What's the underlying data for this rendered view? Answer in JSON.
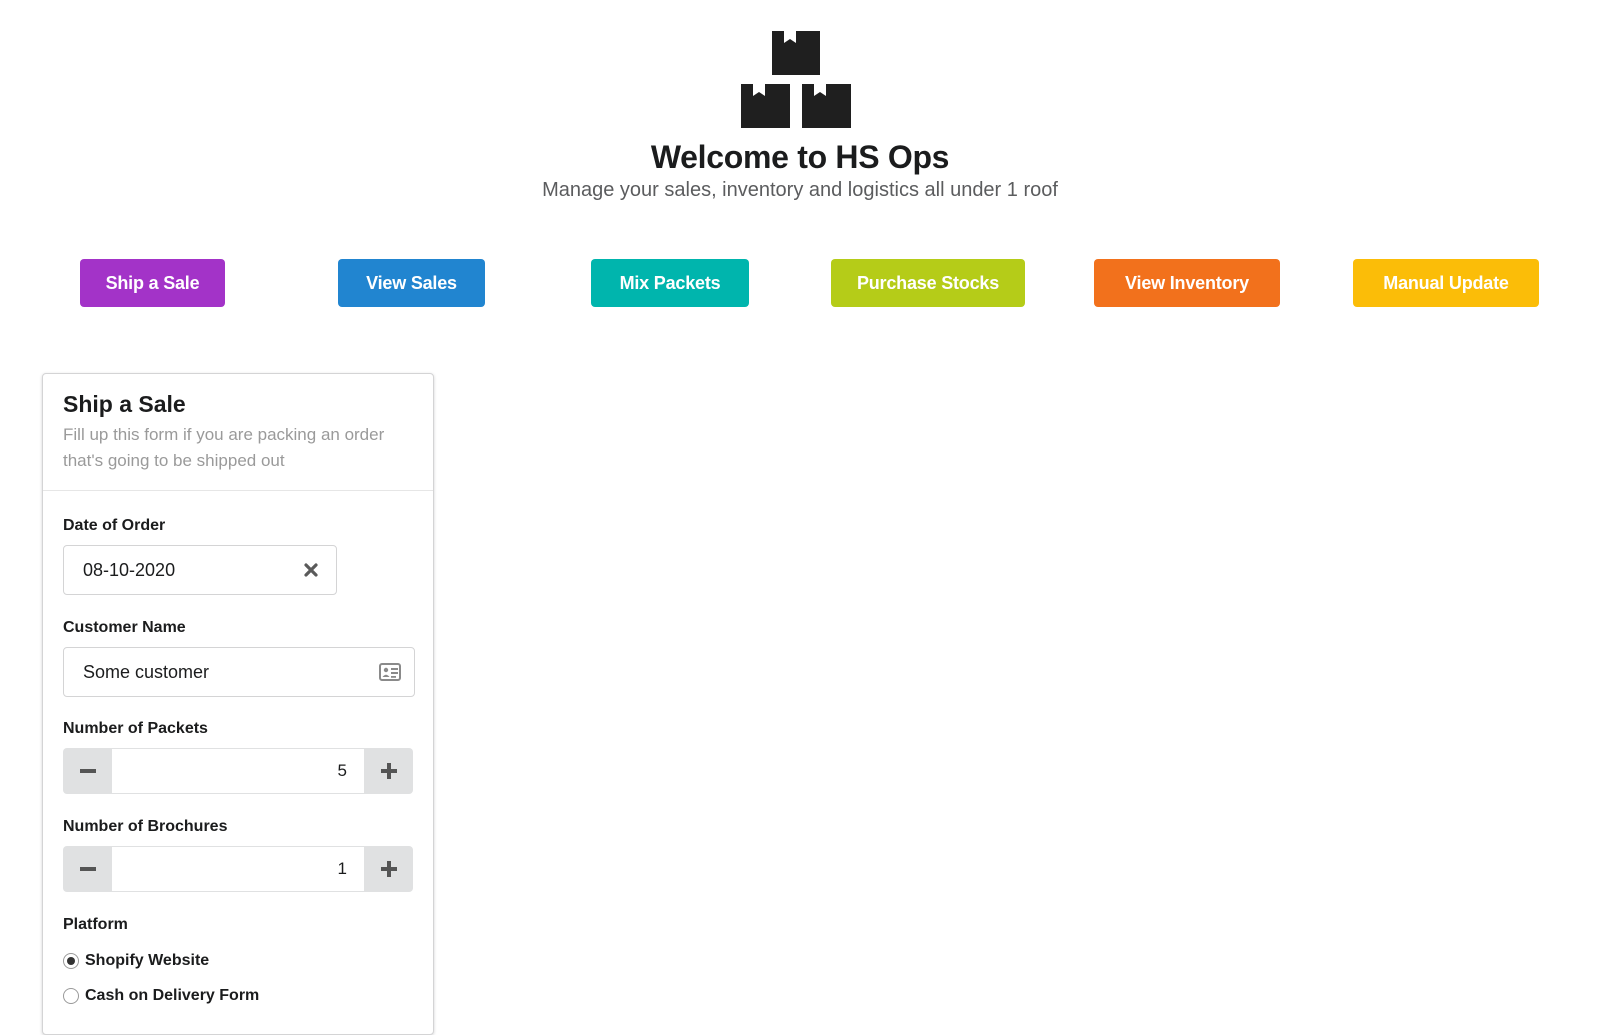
{
  "header": {
    "logo_icon": "boxes-icon",
    "title": "Welcome to HS Ops",
    "subtitle": "Manage your sales, inventory and logistics all under 1 roof"
  },
  "nav": {
    "ship_a_sale": {
      "label": "Ship a Sale",
      "color": "#a333c8"
    },
    "view_sales": {
      "label": "View Sales",
      "color": "#2185d0"
    },
    "mix_packets": {
      "label": "Mix Packets",
      "color": "#00b5ad"
    },
    "purchase_stocks": {
      "label": "Purchase Stocks",
      "color": "#b5cc18"
    },
    "view_inventory": {
      "label": "View Inventory",
      "color": "#f2711c"
    },
    "manual_update": {
      "label": "Manual Update",
      "color": "#fbbd08"
    }
  },
  "form": {
    "title": "Ship a Sale",
    "description": "Fill up this form if you are packing an order that's going to be shipped out",
    "date_of_order": {
      "label": "Date of Order",
      "value": "08-10-2020",
      "clear_icon": "close-icon"
    },
    "customer_name": {
      "label": "Customer Name",
      "value": "Some customer",
      "icon": "id-card-icon"
    },
    "number_of_packets": {
      "label": "Number of Packets",
      "value": "5"
    },
    "number_of_brochures": {
      "label": "Number of Brochures",
      "value": "1"
    },
    "platform": {
      "label": "Platform",
      "options": [
        {
          "label": "Shopify Website",
          "checked": true
        },
        {
          "label": "Cash on Delivery Form",
          "checked": false
        }
      ]
    }
  }
}
